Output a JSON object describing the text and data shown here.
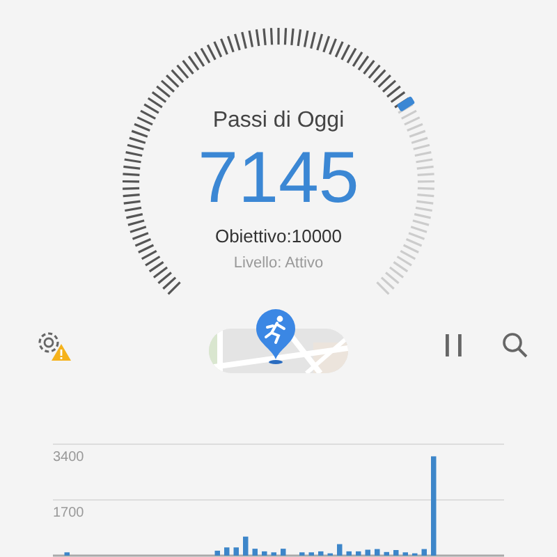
{
  "gauge": {
    "title": "Passi di Oggi",
    "steps": "7145",
    "goal": "Obiettivo:10000",
    "level_text": "Livello: Attivo"
  },
  "toolbar": {
    "settings_warning": true
  },
  "chart": {
    "chart_data": {
      "type": "bar",
      "ylim": [
        0,
        3400
      ],
      "yticks": [
        1700,
        3400
      ],
      "values": [
        0,
        100,
        0,
        0,
        0,
        0,
        0,
        0,
        0,
        0,
        0,
        0,
        0,
        0,
        0,
        0,
        0,
        150,
        250,
        250,
        580,
        210,
        130,
        100,
        210,
        0,
        100,
        100,
        130,
        70,
        350,
        130,
        130,
        180,
        200,
        110,
        170,
        100,
        70,
        200,
        3030,
        0,
        0,
        0,
        0,
        0,
        0,
        0
      ]
    }
  }
}
